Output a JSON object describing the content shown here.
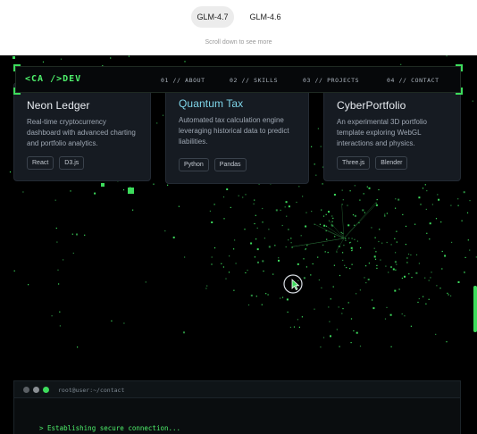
{
  "compare": {
    "tabs": [
      {
        "label": "GLM-4.7",
        "active": true
      },
      {
        "label": "GLM-4.6",
        "active": false
      }
    ],
    "hint": "Scroll down to see more"
  },
  "nav": {
    "logo": "<CA />DEV",
    "links": [
      "01 // ABOUT",
      "02 // SKILLS",
      "03 // PROJECTS",
      "04 // CONTACT"
    ]
  },
  "projects": [
    {
      "title": "Neon Ledger",
      "desc": "Real-time cryptocurrency dashboard with advanced charting and portfolio analytics.",
      "tags": [
        "React",
        "D3.js"
      ]
    },
    {
      "title": "Quantum Tax",
      "desc": "Automated tax calculation engine leveraging historical data to predict liabilities.",
      "tags": [
        "Python",
        "Pandas"
      ]
    },
    {
      "title": "CyberPortfolio",
      "desc": "An experimental 3D portfolio template exploring WebGL interactions and physics.",
      "tags": [
        "Three.js",
        "Blender"
      ]
    }
  ],
  "terminal": {
    "title": "root@user:~/contact",
    "line": "> Establishing secure connection..."
  },
  "colors": {
    "accent": "#3ddc5c",
    "highlight_title": "#7fd6ea",
    "card_bg": "#161b22",
    "page_bg": "#000000"
  }
}
